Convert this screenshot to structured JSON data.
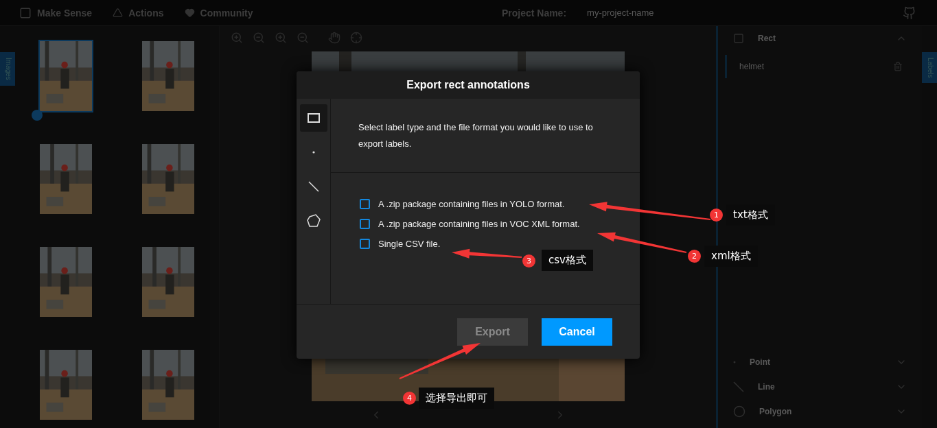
{
  "top_bar": {
    "logo": "Make Sense",
    "menu": [
      "Actions",
      "Community"
    ],
    "project_label": "Project Name:",
    "project_name": "my-project-name"
  },
  "left_tab": "Images",
  "right_tab": "Labels",
  "thumbnails": [
    {
      "selected": true
    },
    {
      "selected": false
    },
    {
      "selected": false
    },
    {
      "selected": false
    },
    {
      "selected": false
    },
    {
      "selected": false
    },
    {
      "selected": false
    },
    {
      "selected": false
    }
  ],
  "label_panel": [
    {
      "kind": "rect",
      "title": "Rect",
      "expanded": true,
      "labels": [
        "helmet"
      ]
    },
    {
      "kind": "point",
      "title": "Point",
      "expanded": false
    },
    {
      "kind": "line",
      "title": "Line",
      "expanded": false
    },
    {
      "kind": "polygon",
      "title": "Polygon",
      "expanded": false
    }
  ],
  "dialog": {
    "title": "Export rect annotations",
    "label_types": [
      {
        "kind": "rect",
        "selected": true
      },
      {
        "kind": "point",
        "selected": false
      },
      {
        "kind": "line",
        "selected": false
      },
      {
        "kind": "polygon",
        "selected": false
      }
    ],
    "description": "Select label type and the file format you would like to use to export labels.",
    "options": [
      {
        "label": "A .zip package containing files in YOLO format.",
        "checked": false
      },
      {
        "label": "A .zip package containing files in VOC XML format.",
        "checked": false
      },
      {
        "label": "Single CSV file.",
        "checked": false
      }
    ],
    "buttons": [
      {
        "label": "Export",
        "kind": "secondary",
        "disabled": true
      },
      {
        "label": "Cancel",
        "kind": "primary",
        "disabled": false
      }
    ]
  },
  "annotations": [
    {
      "number": "1",
      "text": "txt格式"
    },
    {
      "number": "2",
      "text": "xml格式"
    },
    {
      "number": "3",
      "text": "csv格式"
    },
    {
      "number": "4",
      "text": "选择导出即可"
    }
  ]
}
